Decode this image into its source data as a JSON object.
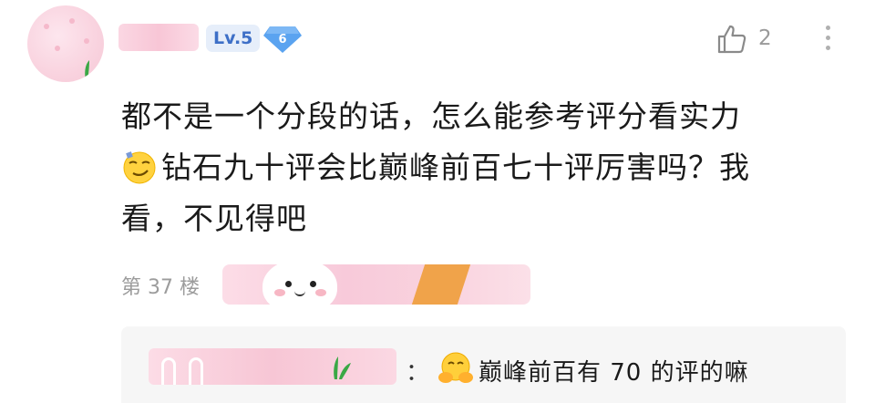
{
  "comment": {
    "level_badge": "Lv.5",
    "level_icon_number": "6",
    "like_count": "2",
    "lines": [
      "都不是一个分段的话，怎么能参考评分看实力",
      "钻石九十评会比巅峰前百七十评厉害吗？我",
      "看，不见得吧"
    ],
    "inline_emoji": "smirk-emoji-icon",
    "floor_label": "第 37 楼"
  },
  "reply": {
    "colon": "：",
    "emoji": "hug-emoji-icon",
    "text": "巅峰前百有 70 的评的嘛"
  },
  "colors": {
    "level_text": "#3d6fc7",
    "level_bg": "#e6eefa",
    "diamond": "#5aa3f0",
    "muted": "#9a9a9a",
    "reply_bg": "#f6f6f6"
  }
}
